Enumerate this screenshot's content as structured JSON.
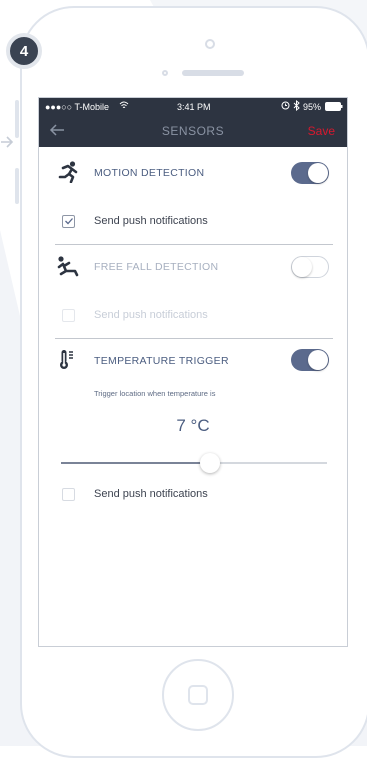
{
  "step_badge": "4",
  "statusbar": {
    "carrier": "●●●○○ T-Mobile",
    "time": "3:41 PM",
    "battery": "95%"
  },
  "navbar": {
    "title": "SENSORS",
    "save_label": "Save"
  },
  "sections": {
    "motion": {
      "title": "MOTION DETECTION",
      "enabled": true,
      "push_label": "Send push notifications",
      "push_checked": true
    },
    "freefall": {
      "title": "FREE FALL DETECTION",
      "enabled": false,
      "push_label": "Send push notifications",
      "push_checked": false
    },
    "temperature": {
      "title": "TEMPERATURE TRIGGER",
      "enabled": true,
      "helper": "Trigger location when temperature is",
      "value": "7 °C",
      "slider_fraction": 0.56,
      "push_label": "Send push notifications",
      "push_checked": false
    }
  },
  "colors": {
    "navbar_bg": "#2d3441",
    "accent": "#5b6a8d",
    "save": "#d8182e"
  },
  "icons": {
    "back": "arrow-left-icon",
    "motion": "running-person-icon",
    "freefall": "falling-person-icon",
    "temperature": "thermometer-icon",
    "checkbox": "checkmark-icon"
  }
}
